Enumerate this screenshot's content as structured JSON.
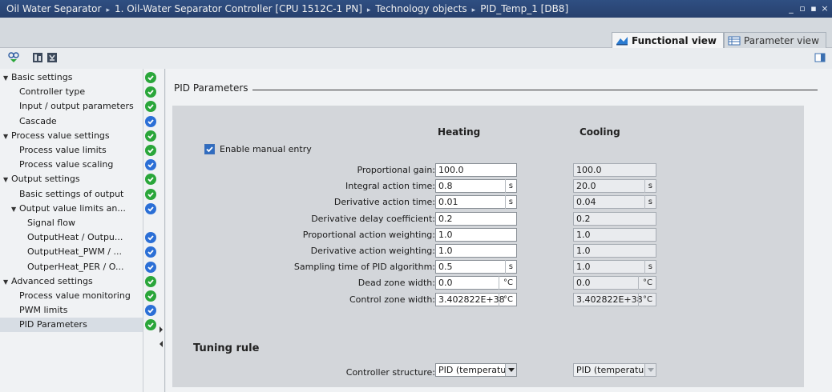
{
  "breadcrumb": {
    "items": [
      "Oil Water Separator",
      "1. Oil-Water Separator Controller [CPU 1512C-1 PN]",
      "Technology objects",
      "PID_Temp_1 [DB8]"
    ],
    "separator": "▸"
  },
  "window_controls": [
    "_",
    "▫",
    "▪",
    "×"
  ],
  "view_tabs": [
    {
      "label": "Functional view",
      "active": true,
      "icon": "functional-view-icon"
    },
    {
      "label": "Parameter view",
      "active": false,
      "icon": "parameter-view-icon"
    }
  ],
  "toolbar": {
    "icons": [
      "monitor-icon",
      "load-icon",
      "snapshot-icon",
      "collapse-panel-icon"
    ]
  },
  "tree": {
    "items": [
      {
        "label": "Basic settings",
        "level": 0,
        "expandable": true,
        "status": "green"
      },
      {
        "label": "Controller type",
        "level": 1,
        "status": "green"
      },
      {
        "label": "Input / output parameters",
        "level": 1,
        "status": "green"
      },
      {
        "label": "Cascade",
        "level": 1,
        "status": "blue"
      },
      {
        "label": "Process value settings",
        "level": 0,
        "expandable": true,
        "status": "green"
      },
      {
        "label": "Process value limits",
        "level": 1,
        "status": "green"
      },
      {
        "label": "Process value scaling",
        "level": 1,
        "status": "blue"
      },
      {
        "label": "Output settings",
        "level": 0,
        "expandable": true,
        "status": "green"
      },
      {
        "label": "Basic settings of output",
        "level": 1,
        "status": "green"
      },
      {
        "label": "Output value limits an...",
        "level": 1,
        "expandable": true,
        "status": "blue"
      },
      {
        "label": "Signal flow",
        "level": 2,
        "status": "none"
      },
      {
        "label": "OutputHeat / Outpu...",
        "level": 2,
        "status": "blue"
      },
      {
        "label": "OutputHeat_PWM / ...",
        "level": 2,
        "status": "blue"
      },
      {
        "label": "OutperHeat_PER / O...",
        "level": 2,
        "status": "blue"
      },
      {
        "label": "Advanced settings",
        "level": 0,
        "expandable": true,
        "status": "green"
      },
      {
        "label": "Process value monitoring",
        "level": 1,
        "status": "green"
      },
      {
        "label": "PWM limits",
        "level": 1,
        "status": "blue"
      },
      {
        "label": "PID Parameters",
        "level": 1,
        "status": "green",
        "selected": true
      }
    ]
  },
  "main": {
    "section_title": "PID Parameters",
    "column_heating": "Heating",
    "column_cooling": "Cooling",
    "enable_manual_entry": {
      "label": "Enable manual entry",
      "checked": true
    },
    "params": [
      {
        "label": "Proportional gain:",
        "heating": "100.0",
        "heating_unit": "",
        "cooling": "100.0",
        "cooling_unit": ""
      },
      {
        "label": "Integral action time:",
        "heating": "0.8",
        "heating_unit": "s",
        "cooling": "20.0",
        "cooling_unit": "s"
      },
      {
        "label": "Derivative action time:",
        "heating": "0.01",
        "heating_unit": "s",
        "cooling": "0.04",
        "cooling_unit": "s"
      },
      {
        "label": "Derivative delay coefficient:",
        "heating": "0.2",
        "heating_unit": "",
        "cooling": "0.2",
        "cooling_unit": ""
      },
      {
        "label": "Proportional action weighting:",
        "heating": "1.0",
        "heating_unit": "",
        "cooling": "1.0",
        "cooling_unit": ""
      },
      {
        "label": "Derivative action weighting:",
        "heating": "1.0",
        "heating_unit": "",
        "cooling": "1.0",
        "cooling_unit": ""
      },
      {
        "label": "Sampling time of PID algorithm:",
        "heating": "0.5",
        "heating_unit": "s",
        "cooling": "1.0",
        "cooling_unit": "s"
      },
      {
        "label": "Dead zone width:",
        "heating": "0.0",
        "heating_unit": "°C",
        "cooling": "0.0",
        "cooling_unit": "°C"
      },
      {
        "label": "Control zone width:",
        "heating": "3.402822E+38",
        "heating_unit": "°C",
        "cooling": "3.402822E+38",
        "cooling_unit": "°C"
      }
    ],
    "tuning_rule": {
      "title": "Tuning rule",
      "controller_structure_label": "Controller structure:",
      "heating_value": "PID (temperatur",
      "cooling_value": "PID (temperatur"
    }
  },
  "colors": {
    "title_bar": "#2f4f82",
    "status_green": "#2aa63a",
    "status_blue": "#2b6fd6",
    "panel": "#d3d6da"
  }
}
